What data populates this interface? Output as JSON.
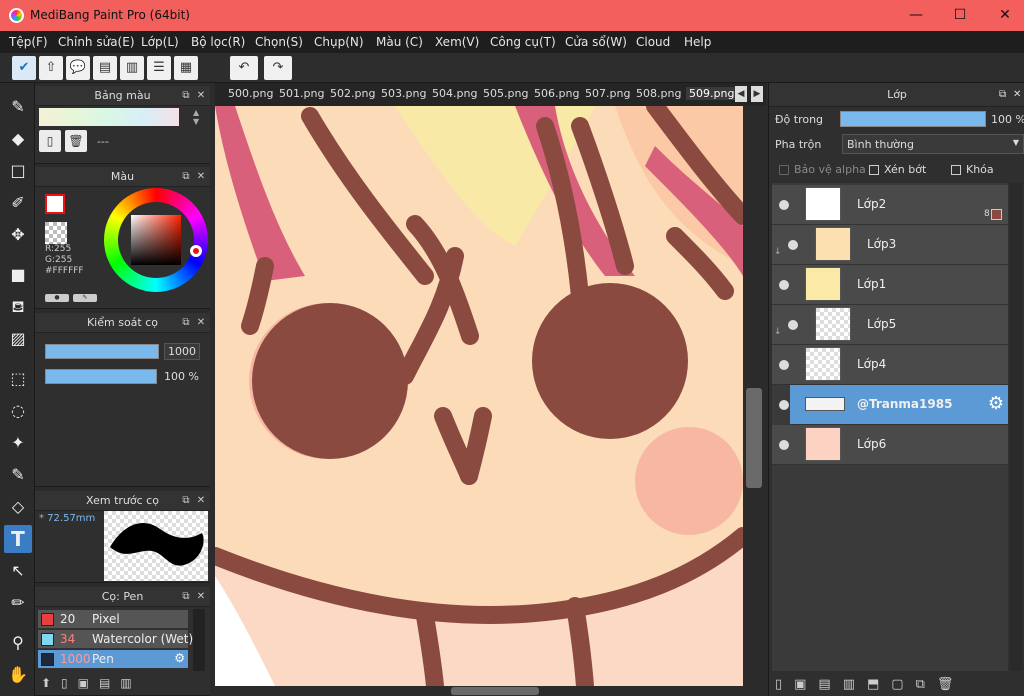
{
  "window": {
    "title": "MediBang Paint Pro (64bit)"
  },
  "menu": [
    "Tệp(F)",
    "Chỉnh sửa(E)",
    "Lớp(L)",
    "Bộ lọc(R)",
    "Chọn(S)",
    "Chụp(N)",
    "Màu (C)",
    "Xem(V)",
    "Công cụ(T)",
    "Cửa sổ(W)",
    "Cloud",
    "Help"
  ],
  "tabs": [
    "500.png",
    "501.png",
    "502.png",
    "503.png",
    "504.png",
    "505.png",
    "506.png",
    "507.png",
    "508.png",
    "509.png"
  ],
  "palette": {
    "title": "Bảng màu",
    "text": "---"
  },
  "color": {
    "title": "Màu",
    "r": "R:255",
    "g": "G:255",
    "hex": "#FFFFFF",
    "accent": "#3b7dc4"
  },
  "brushctl": {
    "title": "Kiểm soát cọ",
    "size": "1000",
    "opacity": "100 %",
    "size_fill": 1.0,
    "opacity_fill": 1.0
  },
  "preview": {
    "title": "Xem trước cọ",
    "size": "* 72.57mm"
  },
  "brushes": {
    "title": "Cọ: Pen",
    "items": [
      {
        "num": "20",
        "name": "Pixel",
        "color": "#e84040"
      },
      {
        "num": "34",
        "name": "Watercolor (Wet)",
        "color": "#7fd8f0"
      },
      {
        "num": "1000",
        "name": "Pen",
        "color": "#1e2a3a"
      }
    ]
  },
  "layers": {
    "title": "Lớp",
    "opacity_label": "Độ trong",
    "opacity_value": "100 %",
    "opacity_fill": 1.0,
    "blend_label": "Pha trộn",
    "blend_value": "Bình thường",
    "protect_alpha": "Bảo vệ alpha",
    "clipping": "Xén bớt",
    "lock": "Khóa",
    "items": [
      {
        "name": "Lớp2",
        "extra": "8"
      },
      {
        "name": "Lớp3"
      },
      {
        "name": "Lớp1"
      },
      {
        "name": "Lớp5"
      },
      {
        "name": "Lớp4"
      },
      {
        "name": "@Tranma1985"
      },
      {
        "name": "Lớp6"
      }
    ]
  }
}
